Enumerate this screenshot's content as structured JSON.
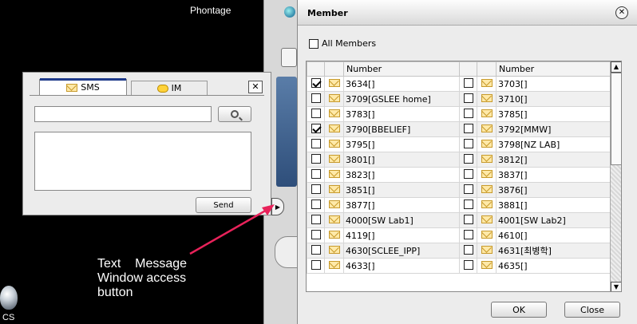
{
  "background": {
    "app_label": "Phontage",
    "corner_label": "CS"
  },
  "sms_window": {
    "tab_sms_label": "SMS",
    "tab_im_label": "IM",
    "close_glyph": "✕",
    "search_value": "",
    "message_value": "",
    "send_label": "Send"
  },
  "annotation": {
    "text_line1": "Text    Message",
    "text_line2": "Window access",
    "text_line3": "button",
    "arrow_color": "#e8225a"
  },
  "member_dialog": {
    "title": "Member",
    "close_glyph": "✕",
    "all_members_label": "All Members",
    "all_members_checked": false,
    "column_header_left": "Number",
    "column_header_right": "Number",
    "rows": [
      {
        "left": {
          "checked": true,
          "number": "3634[]"
        },
        "right": {
          "checked": false,
          "number": "3703[]"
        }
      },
      {
        "left": {
          "checked": false,
          "number": "3709[GSLEE home]"
        },
        "right": {
          "checked": false,
          "number": "3710[]"
        }
      },
      {
        "left": {
          "checked": false,
          "number": "3783[]"
        },
        "right": {
          "checked": false,
          "number": "3785[]"
        }
      },
      {
        "left": {
          "checked": true,
          "number": "3790[BBELIEF]"
        },
        "right": {
          "checked": false,
          "number": "3792[MMW]"
        }
      },
      {
        "left": {
          "checked": false,
          "number": "3795[]"
        },
        "right": {
          "checked": false,
          "number": "3798[NZ LAB]"
        }
      },
      {
        "left": {
          "checked": false,
          "number": "3801[]"
        },
        "right": {
          "checked": false,
          "number": "3812[]"
        }
      },
      {
        "left": {
          "checked": false,
          "number": "3823[]"
        },
        "right": {
          "checked": false,
          "number": "3837[]"
        }
      },
      {
        "left": {
          "checked": false,
          "number": "3851[]"
        },
        "right": {
          "checked": false,
          "number": "3876[]"
        }
      },
      {
        "left": {
          "checked": false,
          "number": "3877[]"
        },
        "right": {
          "checked": false,
          "number": "3881[]"
        }
      },
      {
        "left": {
          "checked": false,
          "number": "4000[SW Lab1]"
        },
        "right": {
          "checked": false,
          "number": "4001[SW Lab2]"
        }
      },
      {
        "left": {
          "checked": false,
          "number": "4119[]"
        },
        "right": {
          "checked": false,
          "number": "4610[]"
        }
      },
      {
        "left": {
          "checked": false,
          "number": "4630[SCLEE_IPP]"
        },
        "right": {
          "checked": false,
          "number": "4631[최병학]"
        }
      },
      {
        "left": {
          "checked": false,
          "number": "4633[]"
        },
        "right": {
          "checked": false,
          "number": "4635[]"
        }
      }
    ],
    "ok_label": "OK",
    "close_label": "Close"
  },
  "icons": {
    "sms_tab": "envelope-icon",
    "im_tab": "chat-bubble-icon",
    "search": "magnifier-icon",
    "row_icon": "envelope-icon",
    "access_button": "triangle-right-icon"
  }
}
